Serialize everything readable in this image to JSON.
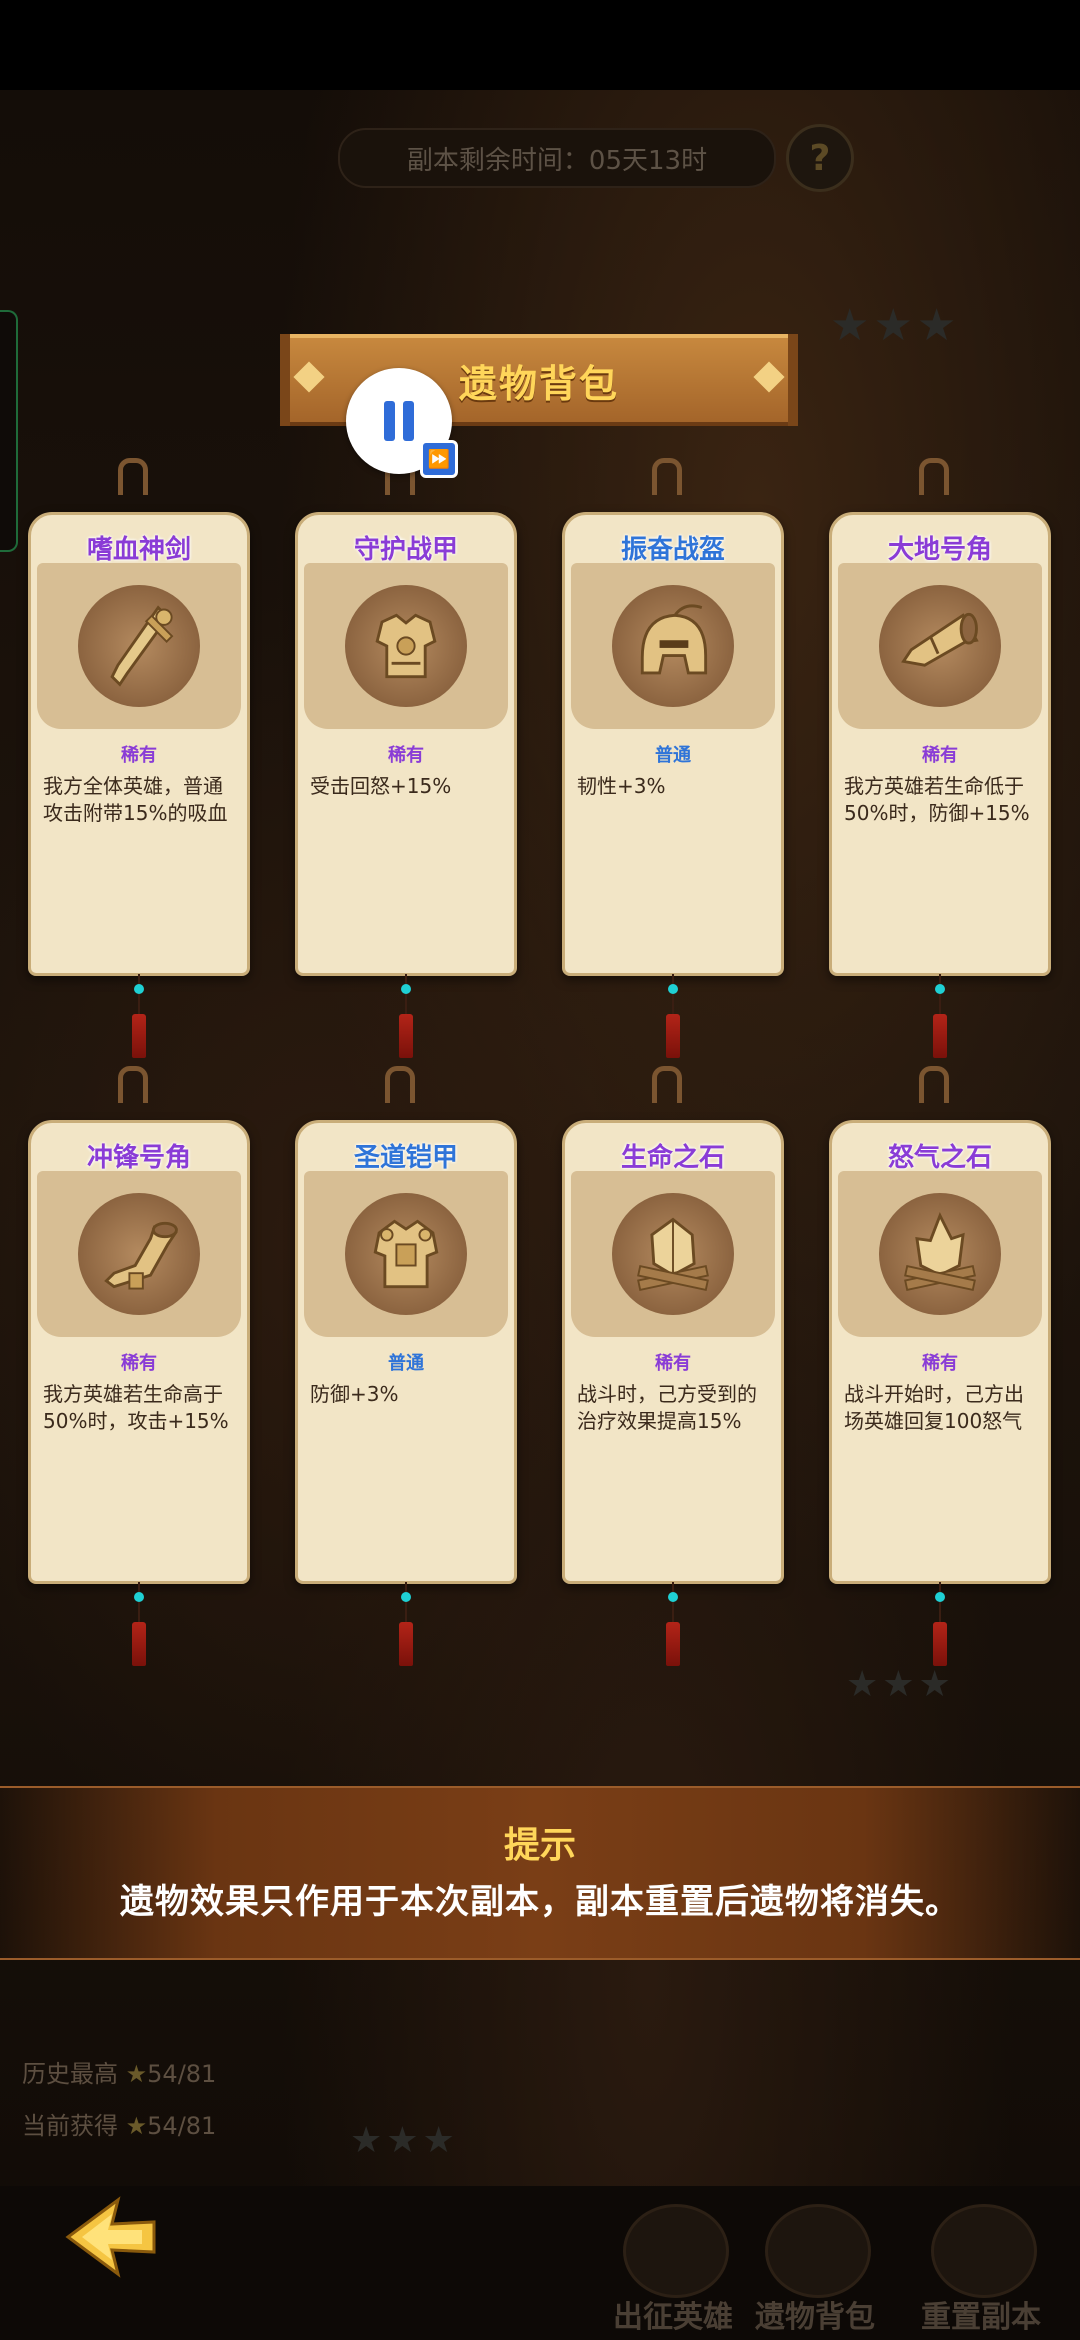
{
  "header": {
    "timer_label": "副本剩余时间：05天13时",
    "help_symbol": "?"
  },
  "panel": {
    "title": "遗物背包"
  },
  "relics": [
    {
      "name": "嗜血神剑",
      "rarity": "稀有",
      "tier": "rare",
      "icon": "sword-icon",
      "description": "我方全体英雄，普通攻击附带15%的吸血"
    },
    {
      "name": "守护战甲",
      "rarity": "稀有",
      "tier": "rare",
      "icon": "armor-icon",
      "description": "受击回怒+15%"
    },
    {
      "name": "振奋战盔",
      "rarity": "普通",
      "tier": "common",
      "icon": "helmet-icon",
      "description": "韧性+3%"
    },
    {
      "name": "大地号角",
      "rarity": "稀有",
      "tier": "rare",
      "icon": "horn-icon",
      "description": "我方英雄若生命低于50%时，防御+15%"
    },
    {
      "name": "冲锋号角",
      "rarity": "稀有",
      "tier": "rare",
      "icon": "horn-icon",
      "description": "我方英雄若生命高于50%时，攻击+15%"
    },
    {
      "name": "圣道铠甲",
      "rarity": "普通",
      "tier": "common",
      "icon": "armor-icon",
      "description": "防御+3%"
    },
    {
      "name": "生命之石",
      "rarity": "稀有",
      "tier": "rare",
      "icon": "stone-icon",
      "description": "战斗时，己方受到的治疗效果提高15%"
    },
    {
      "name": "怒气之石",
      "rarity": "稀有",
      "tier": "rare",
      "icon": "stone-icon",
      "description": "战斗开始时，己方出场英雄回复100怒气"
    }
  ],
  "tip": {
    "title": "提示",
    "text": "遗物效果只作用于本次副本，副本重置后遗物将消失。"
  },
  "stats": {
    "history_label": "历史最高",
    "history_value": "54/81",
    "current_label": "当前获得",
    "current_value": "54/81"
  },
  "nav": {
    "heroes": "出征英雄",
    "relics": "遗物背包",
    "reset": "重置副本"
  },
  "colors": {
    "rare": "#8a3cd6",
    "common": "#2f74d8",
    "accent": "#ffd65a"
  }
}
